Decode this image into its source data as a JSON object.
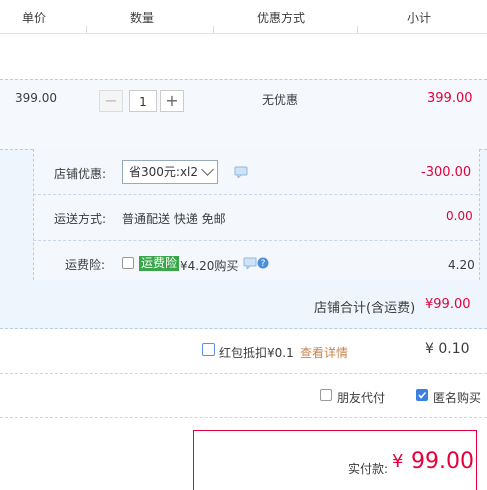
{
  "header": {
    "col_price": "单价",
    "col_qty": "数量",
    "col_promo": "优惠方式",
    "col_subtotal": "小计"
  },
  "item": {
    "price": "399.00",
    "qty_minus": "−",
    "qty_value": "1",
    "qty_plus": "+",
    "promo": "无优惠",
    "subtotal": "399.00"
  },
  "shop": {
    "discount_label": "店铺优惠:",
    "discount_select": "省300元:xl2",
    "discount_amount": "-300.00",
    "shipping_label": "运送方式:",
    "shipping_value": "普通配送 快递 免邮",
    "shipping_amount": "0.00",
    "insurance_label": "运费险:",
    "insurance_tag": "运费险",
    "insurance_price": "¥4.20购买",
    "insurance_amount": "4.20",
    "shop_total_label": "店铺合计(含运费)",
    "shop_total_value": "¥99.00"
  },
  "redpacket": {
    "label": "红包抵扣¥0.1",
    "link": "查看详情",
    "amount": "¥ 0.10",
    "checked": false
  },
  "options": {
    "friend_pay": "朋友代付",
    "friend_pay_checked": false,
    "anonymous": "匿名购买",
    "anonymous_checked": true
  },
  "payment": {
    "label": "实付款:",
    "currency": "¥",
    "amount": "99.00"
  },
  "colors": {
    "accent_red": "#e4003a",
    "accent_blue": "#3b7fe0",
    "tag_green": "#3aa64a"
  }
}
